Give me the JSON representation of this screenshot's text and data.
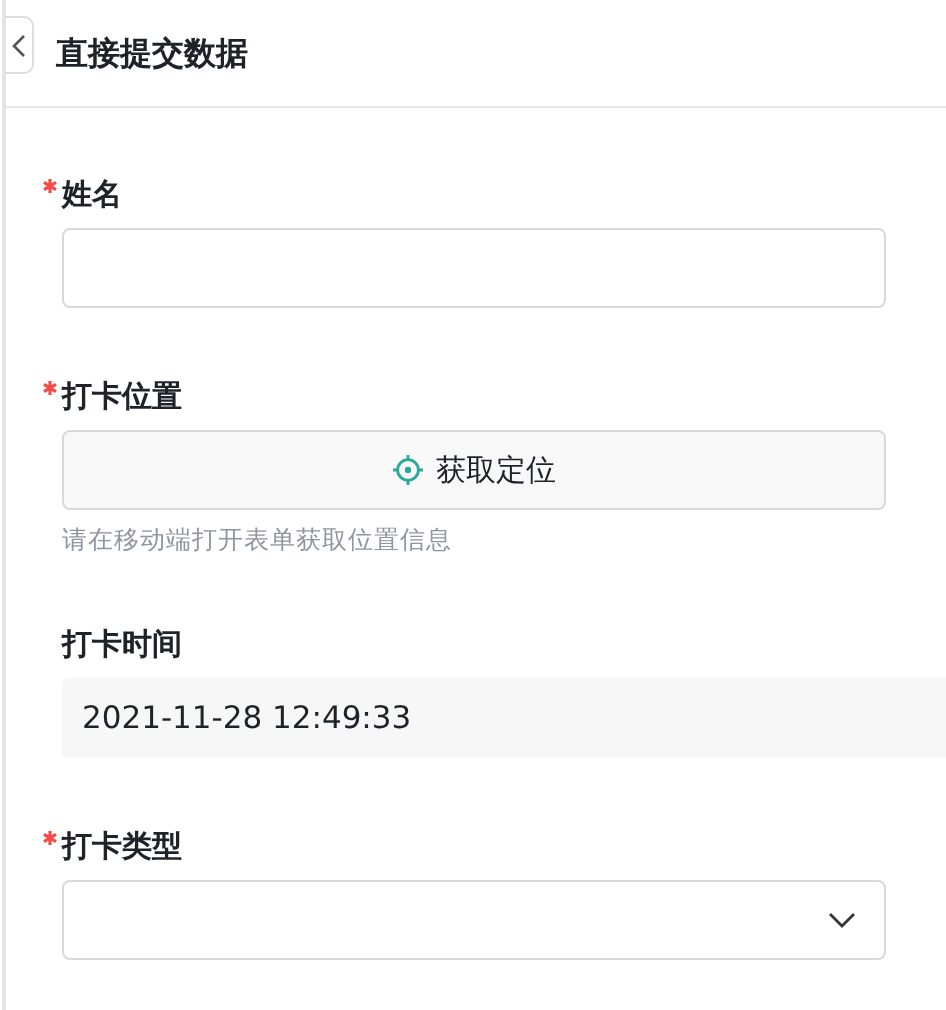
{
  "header": {
    "title": "直接提交数据"
  },
  "fields": [
    {
      "kind": "text",
      "label": "姓名",
      "required": true
    },
    {
      "kind": "location",
      "label": "打卡位置",
      "required": true,
      "button": "获取定位",
      "hint": "请在移动端打开表单获取位置信息"
    },
    {
      "kind": "readonly",
      "label": "打卡时间",
      "required": false,
      "value": "2021-11-28 12:49:33"
    },
    {
      "kind": "select",
      "label": "打卡类型",
      "required": true
    }
  ]
}
